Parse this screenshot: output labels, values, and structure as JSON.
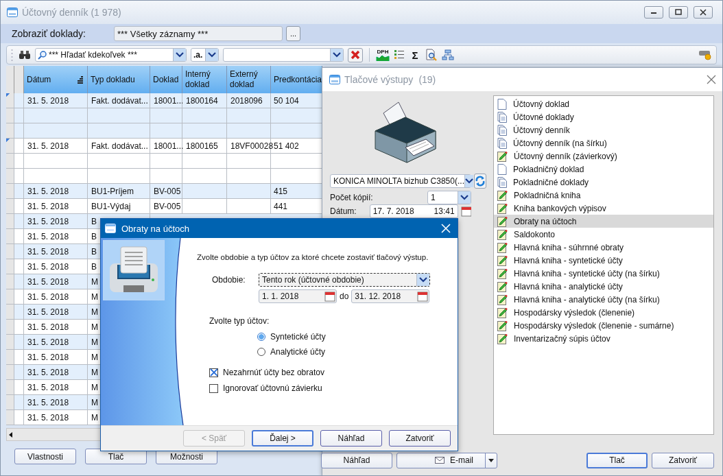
{
  "main_window": {
    "title": "Účtovný denník (1 978)"
  },
  "filter": {
    "label": "Zobraziť doklady:",
    "value": "*** Všetky záznamy ***",
    "button": "..."
  },
  "search": {
    "scope": "*** Hľadať kdekoľvek ***",
    "mode": ".a.",
    "vat_label": "DPH",
    "sum_label": "Σ"
  },
  "table": {
    "columns": [
      {
        "label": "Dátum",
        "sorted": true
      },
      {
        "label": "Typ dokladu",
        "sorted": false
      },
      {
        "label": "Doklad",
        "sorted": false
      },
      {
        "label": "Interný doklad",
        "sorted": false
      },
      {
        "label": "Externý doklad",
        "sorted": false
      },
      {
        "label": "Predkontácia",
        "sorted": false
      }
    ],
    "rows": [
      {
        "shaded": true,
        "marked": true,
        "cells": [
          "31. 5. 2018",
          "Fakt. dodávat...",
          "18001...",
          "1800164",
          "2018096",
          "50 104"
        ]
      },
      {
        "shaded": true,
        "marked": false,
        "cells": []
      },
      {
        "shaded": true,
        "marked": false,
        "cells": []
      },
      {
        "shaded": false,
        "marked": true,
        "cells": [
          "31. 5. 2018",
          "Fakt. dodávat...",
          "18001...",
          "1800165",
          "18VF00028",
          "51 402"
        ]
      },
      {
        "shaded": false,
        "marked": false,
        "cells": []
      },
      {
        "shaded": false,
        "marked": false,
        "cells": []
      },
      {
        "shaded": true,
        "marked": false,
        "cells": [
          "31. 5. 2018",
          "BU1-Príjem",
          "BV-005",
          null,
          null,
          "415"
        ]
      },
      {
        "shaded": false,
        "marked": false,
        "cells": [
          "31. 5. 2018",
          "BU1-Výdaj",
          "BV-005",
          null,
          null,
          "441"
        ]
      },
      {
        "shaded": true,
        "marked": false,
        "cells": [
          "31. 5. 2018",
          "B"
        ]
      },
      {
        "shaded": false,
        "marked": false,
        "cells": [
          "31. 5. 2018",
          "B"
        ]
      },
      {
        "shaded": true,
        "marked": false,
        "cells": [
          "31. 5. 2018",
          "B"
        ]
      },
      {
        "shaded": false,
        "marked": false,
        "cells": [
          "31. 5. 2018",
          "B"
        ]
      },
      {
        "shaded": true,
        "marked": false,
        "cells": [
          "31. 5. 2018",
          "M"
        ]
      },
      {
        "shaded": false,
        "marked": false,
        "cells": [
          "31. 5. 2018",
          "M"
        ]
      },
      {
        "shaded": true,
        "marked": false,
        "cells": [
          "31. 5. 2018",
          "M"
        ]
      },
      {
        "shaded": false,
        "marked": false,
        "cells": [
          "31. 5. 2018",
          "M"
        ]
      },
      {
        "shaded": true,
        "marked": false,
        "cells": [
          "31. 5. 2018",
          "M"
        ]
      },
      {
        "shaded": false,
        "marked": false,
        "cells": [
          "31. 5. 2018",
          "M"
        ]
      },
      {
        "shaded": true,
        "marked": false,
        "cells": [
          "31. 5. 2018",
          "M"
        ]
      },
      {
        "shaded": false,
        "marked": false,
        "cells": [
          "31. 5. 2018",
          "M"
        ]
      },
      {
        "shaded": true,
        "marked": false,
        "cells": [
          "31. 5. 2018",
          "M"
        ]
      },
      {
        "shaded": false,
        "marked": false,
        "cells": [
          "31. 5. 2018",
          "M"
        ]
      }
    ]
  },
  "bottom_buttons": [
    "Vlastnosti",
    "Tlač",
    "Možnosti"
  ],
  "print_window": {
    "title": "Tlačové výstupy",
    "count": "(19)",
    "printer": "KONICA MINOLTA bizhub C3850(...",
    "copies_label": "Počet kópií:",
    "copies": "1",
    "date_label": "Dátum:",
    "date": "17. 7. 2018",
    "time": "13:41",
    "reports": [
      {
        "label": "Účtovný doklad",
        "kind": "page",
        "selected": false
      },
      {
        "label": "Účtovné doklady",
        "kind": "pages",
        "selected": false
      },
      {
        "label": "Účtovný denník",
        "kind": "pages",
        "selected": false
      },
      {
        "label": "Účtovný denník (na šírku)",
        "kind": "pages",
        "selected": false
      },
      {
        "label": "Účtovný denník (závierkový)",
        "kind": "edit",
        "selected": false
      },
      {
        "label": "Pokladničný doklad",
        "kind": "page",
        "selected": false
      },
      {
        "label": "Pokladničné doklady",
        "kind": "pages",
        "selected": false
      },
      {
        "label": "Pokladničná kniha",
        "kind": "edit",
        "selected": false
      },
      {
        "label": "Kniha bankových výpisov",
        "kind": "edit",
        "selected": false
      },
      {
        "label": "Obraty na účtoch",
        "kind": "edit",
        "selected": true
      },
      {
        "label": "Saldokonto",
        "kind": "edit",
        "selected": false
      },
      {
        "label": "Hlavná kniha - súhrnné obraty",
        "kind": "edit",
        "selected": false
      },
      {
        "label": "Hlavná kniha - syntetické účty",
        "kind": "edit",
        "selected": false
      },
      {
        "label": "Hlavná kniha - syntetické účty (na šírku)",
        "kind": "edit",
        "selected": false
      },
      {
        "label": "Hlavná kniha - analytické účty",
        "kind": "edit",
        "selected": false
      },
      {
        "label": "Hlavná kniha - analytické účty (na šírku)",
        "kind": "edit",
        "selected": false
      },
      {
        "label": "Hospodársky výsledok (členenie)",
        "kind": "edit",
        "selected": false
      },
      {
        "label": "Hospodársky výsledok (členenie - sumárne)",
        "kind": "edit",
        "selected": false
      },
      {
        "label": "Inventarizačný súpis účtov",
        "kind": "edit",
        "selected": false
      }
    ],
    "buttons": [
      {
        "label": "Náhľad",
        "kind": "plain"
      },
      {
        "label": "E-mail",
        "kind": "split"
      },
      {
        "label": "Tlač",
        "kind": "default"
      },
      {
        "label": "Zatvoriť",
        "kind": "plain"
      }
    ]
  },
  "dialog": {
    "title": "Obraty na účtoch",
    "intro": "Zvolte obdobie a typ účtov za ktoré chcete zostaviť tlačový výstup.",
    "period_label": "Obdobie:",
    "period": "Tento rok (účtovné obdobie)",
    "date_from": "1. 1. 2018",
    "date_sep": "do",
    "date_to": "31. 12. 2018",
    "type_label": "Zvolte typ účtov:",
    "account_types": [
      {
        "label": "Syntetické účty",
        "selected": true
      },
      {
        "label": "Analytické účty",
        "selected": false
      }
    ],
    "options": [
      {
        "label": "Nezahrnúť účty bez obratov",
        "checked": true
      },
      {
        "label": "Ignorovať účtovnú závierku",
        "checked": false
      }
    ],
    "buttons": [
      {
        "label": "< Späť",
        "disabled": true,
        "default": false
      },
      {
        "label": "Ďalej >",
        "disabled": false,
        "default": true
      },
      {
        "label": "Náhľad",
        "disabled": false,
        "default": false
      },
      {
        "label": "Zatvoriť",
        "disabled": false,
        "default": false
      }
    ]
  }
}
